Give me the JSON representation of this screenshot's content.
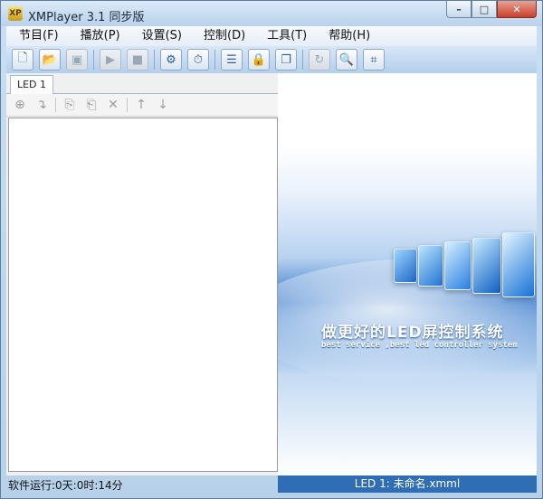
{
  "window": {
    "title": "XMPlayer 3.1 同步版",
    "icon_text": "XP"
  },
  "menus": [
    {
      "label": "节目(F)"
    },
    {
      "label": "播放(P)"
    },
    {
      "label": "设置(S)"
    },
    {
      "label": "控制(D)"
    },
    {
      "label": "工具(T)"
    },
    {
      "label": "帮助(H)"
    }
  ],
  "toolbar_icons": [
    "new-file-icon",
    "open-folder-icon",
    "save-icon",
    "play-icon",
    "stop-icon",
    "settings-gear-icon",
    "timer-icon",
    "screen-config-icon",
    "lock-icon",
    "windows-icon",
    "refresh-icon",
    "search-icon",
    "network-grid-icon"
  ],
  "left_panel": {
    "tab_label": "LED 1",
    "tool_icons": [
      "add-page-icon",
      "insert-icon",
      "copy-icon",
      "paste-icon",
      "delete-icon",
      "move-up-icon",
      "move-down-icon"
    ]
  },
  "banner": {
    "slogan_cn": "做更好的LED屏控制系统",
    "slogan_en": "best service ,best led controller system"
  },
  "status": {
    "runtime": "软件运行:0天:0时:14分",
    "file": "LED 1: 未命名.xmml"
  },
  "colors": {
    "accent": "#2f6db5",
    "title_bg": "#c9dff3"
  }
}
